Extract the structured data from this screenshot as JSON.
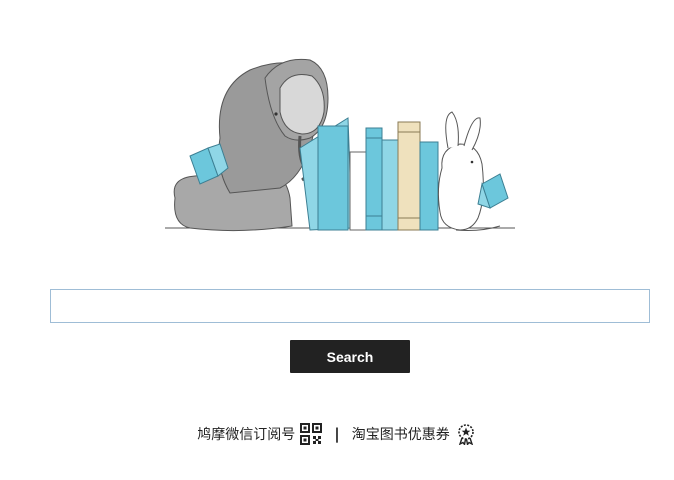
{
  "illustration": {
    "name": "elephant-bunny-bookends",
    "colors": {
      "elephant": "#9e9e9e",
      "book_blue": "#6cc7dc",
      "book_cream": "#efe1bd",
      "bunny": "#ffffff"
    }
  },
  "search": {
    "placeholder": "",
    "value": "",
    "button_label": "Search"
  },
  "footer": {
    "wechat_label": "鸠摩微信订阅号",
    "wechat_icon": "qr-code-icon",
    "separator": "|",
    "taobao_label": "淘宝图书优惠券",
    "taobao_icon": "coupon-badge-icon"
  },
  "colors": {
    "button_bg": "#222222",
    "button_text": "#ffffff",
    "input_border": "#9fbdd6"
  }
}
